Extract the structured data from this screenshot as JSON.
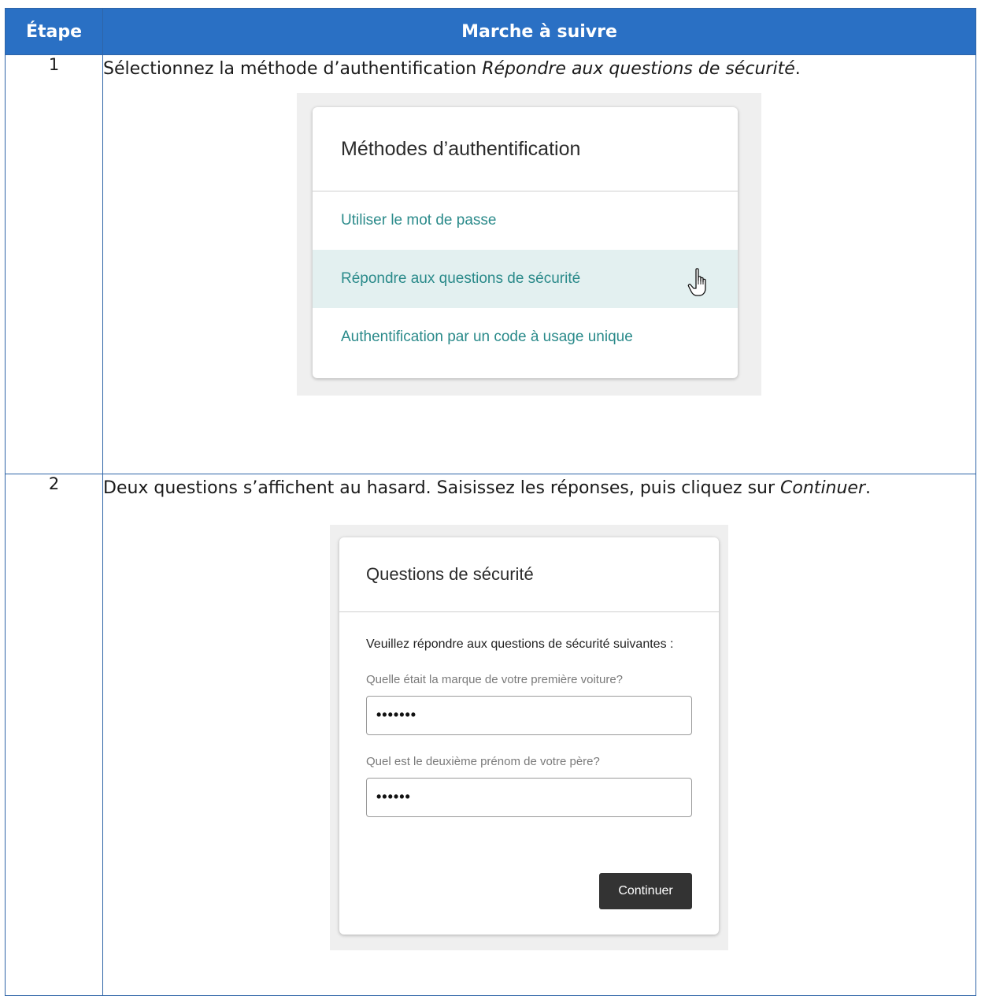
{
  "table": {
    "header_step": "Étape",
    "header_instructions": "Marche à suivre",
    "rows": [
      {
        "number": "1",
        "text_before": "Sélectionnez la méthode d’authentification ",
        "text_emphasis": "Répondre aux questions de sécurité",
        "text_after": "."
      },
      {
        "number": "2",
        "text_before": "Deux questions s’affichent au hasard. Saisissez les réponses, puis cliquez sur ",
        "text_emphasis": "Continuer",
        "text_after": "."
      }
    ]
  },
  "auth_methods": {
    "title": "Méthodes d’authentification",
    "items": [
      "Utiliser le mot de passe",
      "Répondre aux questions de sécurité",
      "Authentification par un code à usage unique"
    ],
    "highlighted_item": "Répondre aux questions de sécurité",
    "cursor": "hand-pointer-icon"
  },
  "security_questions": {
    "title": "Questions de sécurité",
    "intro": "Veuillez répondre aux questions de sécurité suivantes :",
    "question1": "Quelle était la marque de votre première voiture?",
    "answer1": "•••••••",
    "question2": "Quel est le deuxième prénom de votre père?",
    "answer2": "••••••",
    "button": "Continuer"
  },
  "colors": {
    "header_blue": "#2a70c4",
    "link_teal": "#2a8a8a",
    "highlight": "#e3f0f0",
    "button_dark": "#333333"
  }
}
